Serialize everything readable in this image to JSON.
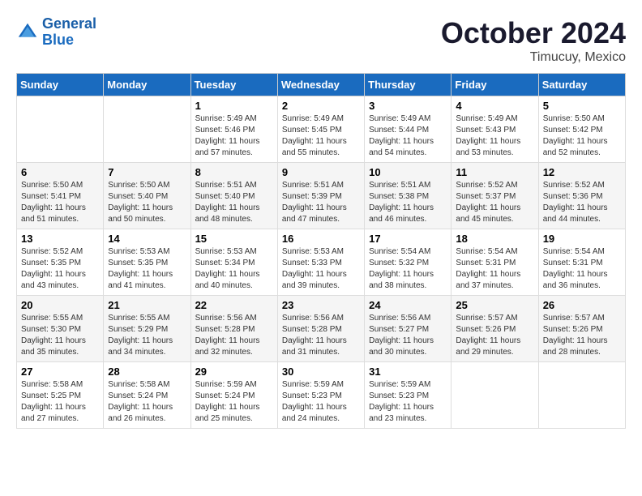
{
  "logo": {
    "line1": "General",
    "line2": "Blue"
  },
  "title": "October 2024",
  "location": "Timucuy, Mexico",
  "days_header": [
    "Sunday",
    "Monday",
    "Tuesday",
    "Wednesday",
    "Thursday",
    "Friday",
    "Saturday"
  ],
  "weeks": [
    [
      {
        "day": "",
        "info": ""
      },
      {
        "day": "",
        "info": ""
      },
      {
        "day": "1",
        "info": "Sunrise: 5:49 AM\nSunset: 5:46 PM\nDaylight: 11 hours and 57 minutes."
      },
      {
        "day": "2",
        "info": "Sunrise: 5:49 AM\nSunset: 5:45 PM\nDaylight: 11 hours and 55 minutes."
      },
      {
        "day": "3",
        "info": "Sunrise: 5:49 AM\nSunset: 5:44 PM\nDaylight: 11 hours and 54 minutes."
      },
      {
        "day": "4",
        "info": "Sunrise: 5:49 AM\nSunset: 5:43 PM\nDaylight: 11 hours and 53 minutes."
      },
      {
        "day": "5",
        "info": "Sunrise: 5:50 AM\nSunset: 5:42 PM\nDaylight: 11 hours and 52 minutes."
      }
    ],
    [
      {
        "day": "6",
        "info": "Sunrise: 5:50 AM\nSunset: 5:41 PM\nDaylight: 11 hours and 51 minutes."
      },
      {
        "day": "7",
        "info": "Sunrise: 5:50 AM\nSunset: 5:40 PM\nDaylight: 11 hours and 50 minutes."
      },
      {
        "day": "8",
        "info": "Sunrise: 5:51 AM\nSunset: 5:40 PM\nDaylight: 11 hours and 48 minutes."
      },
      {
        "day": "9",
        "info": "Sunrise: 5:51 AM\nSunset: 5:39 PM\nDaylight: 11 hours and 47 minutes."
      },
      {
        "day": "10",
        "info": "Sunrise: 5:51 AM\nSunset: 5:38 PM\nDaylight: 11 hours and 46 minutes."
      },
      {
        "day": "11",
        "info": "Sunrise: 5:52 AM\nSunset: 5:37 PM\nDaylight: 11 hours and 45 minutes."
      },
      {
        "day": "12",
        "info": "Sunrise: 5:52 AM\nSunset: 5:36 PM\nDaylight: 11 hours and 44 minutes."
      }
    ],
    [
      {
        "day": "13",
        "info": "Sunrise: 5:52 AM\nSunset: 5:35 PM\nDaylight: 11 hours and 43 minutes."
      },
      {
        "day": "14",
        "info": "Sunrise: 5:53 AM\nSunset: 5:35 PM\nDaylight: 11 hours and 41 minutes."
      },
      {
        "day": "15",
        "info": "Sunrise: 5:53 AM\nSunset: 5:34 PM\nDaylight: 11 hours and 40 minutes."
      },
      {
        "day": "16",
        "info": "Sunrise: 5:53 AM\nSunset: 5:33 PM\nDaylight: 11 hours and 39 minutes."
      },
      {
        "day": "17",
        "info": "Sunrise: 5:54 AM\nSunset: 5:32 PM\nDaylight: 11 hours and 38 minutes."
      },
      {
        "day": "18",
        "info": "Sunrise: 5:54 AM\nSunset: 5:31 PM\nDaylight: 11 hours and 37 minutes."
      },
      {
        "day": "19",
        "info": "Sunrise: 5:54 AM\nSunset: 5:31 PM\nDaylight: 11 hours and 36 minutes."
      }
    ],
    [
      {
        "day": "20",
        "info": "Sunrise: 5:55 AM\nSunset: 5:30 PM\nDaylight: 11 hours and 35 minutes."
      },
      {
        "day": "21",
        "info": "Sunrise: 5:55 AM\nSunset: 5:29 PM\nDaylight: 11 hours and 34 minutes."
      },
      {
        "day": "22",
        "info": "Sunrise: 5:56 AM\nSunset: 5:28 PM\nDaylight: 11 hours and 32 minutes."
      },
      {
        "day": "23",
        "info": "Sunrise: 5:56 AM\nSunset: 5:28 PM\nDaylight: 11 hours and 31 minutes."
      },
      {
        "day": "24",
        "info": "Sunrise: 5:56 AM\nSunset: 5:27 PM\nDaylight: 11 hours and 30 minutes."
      },
      {
        "day": "25",
        "info": "Sunrise: 5:57 AM\nSunset: 5:26 PM\nDaylight: 11 hours and 29 minutes."
      },
      {
        "day": "26",
        "info": "Sunrise: 5:57 AM\nSunset: 5:26 PM\nDaylight: 11 hours and 28 minutes."
      }
    ],
    [
      {
        "day": "27",
        "info": "Sunrise: 5:58 AM\nSunset: 5:25 PM\nDaylight: 11 hours and 27 minutes."
      },
      {
        "day": "28",
        "info": "Sunrise: 5:58 AM\nSunset: 5:24 PM\nDaylight: 11 hours and 26 minutes."
      },
      {
        "day": "29",
        "info": "Sunrise: 5:59 AM\nSunset: 5:24 PM\nDaylight: 11 hours and 25 minutes."
      },
      {
        "day": "30",
        "info": "Sunrise: 5:59 AM\nSunset: 5:23 PM\nDaylight: 11 hours and 24 minutes."
      },
      {
        "day": "31",
        "info": "Sunrise: 5:59 AM\nSunset: 5:23 PM\nDaylight: 11 hours and 23 minutes."
      },
      {
        "day": "",
        "info": ""
      },
      {
        "day": "",
        "info": ""
      }
    ]
  ]
}
